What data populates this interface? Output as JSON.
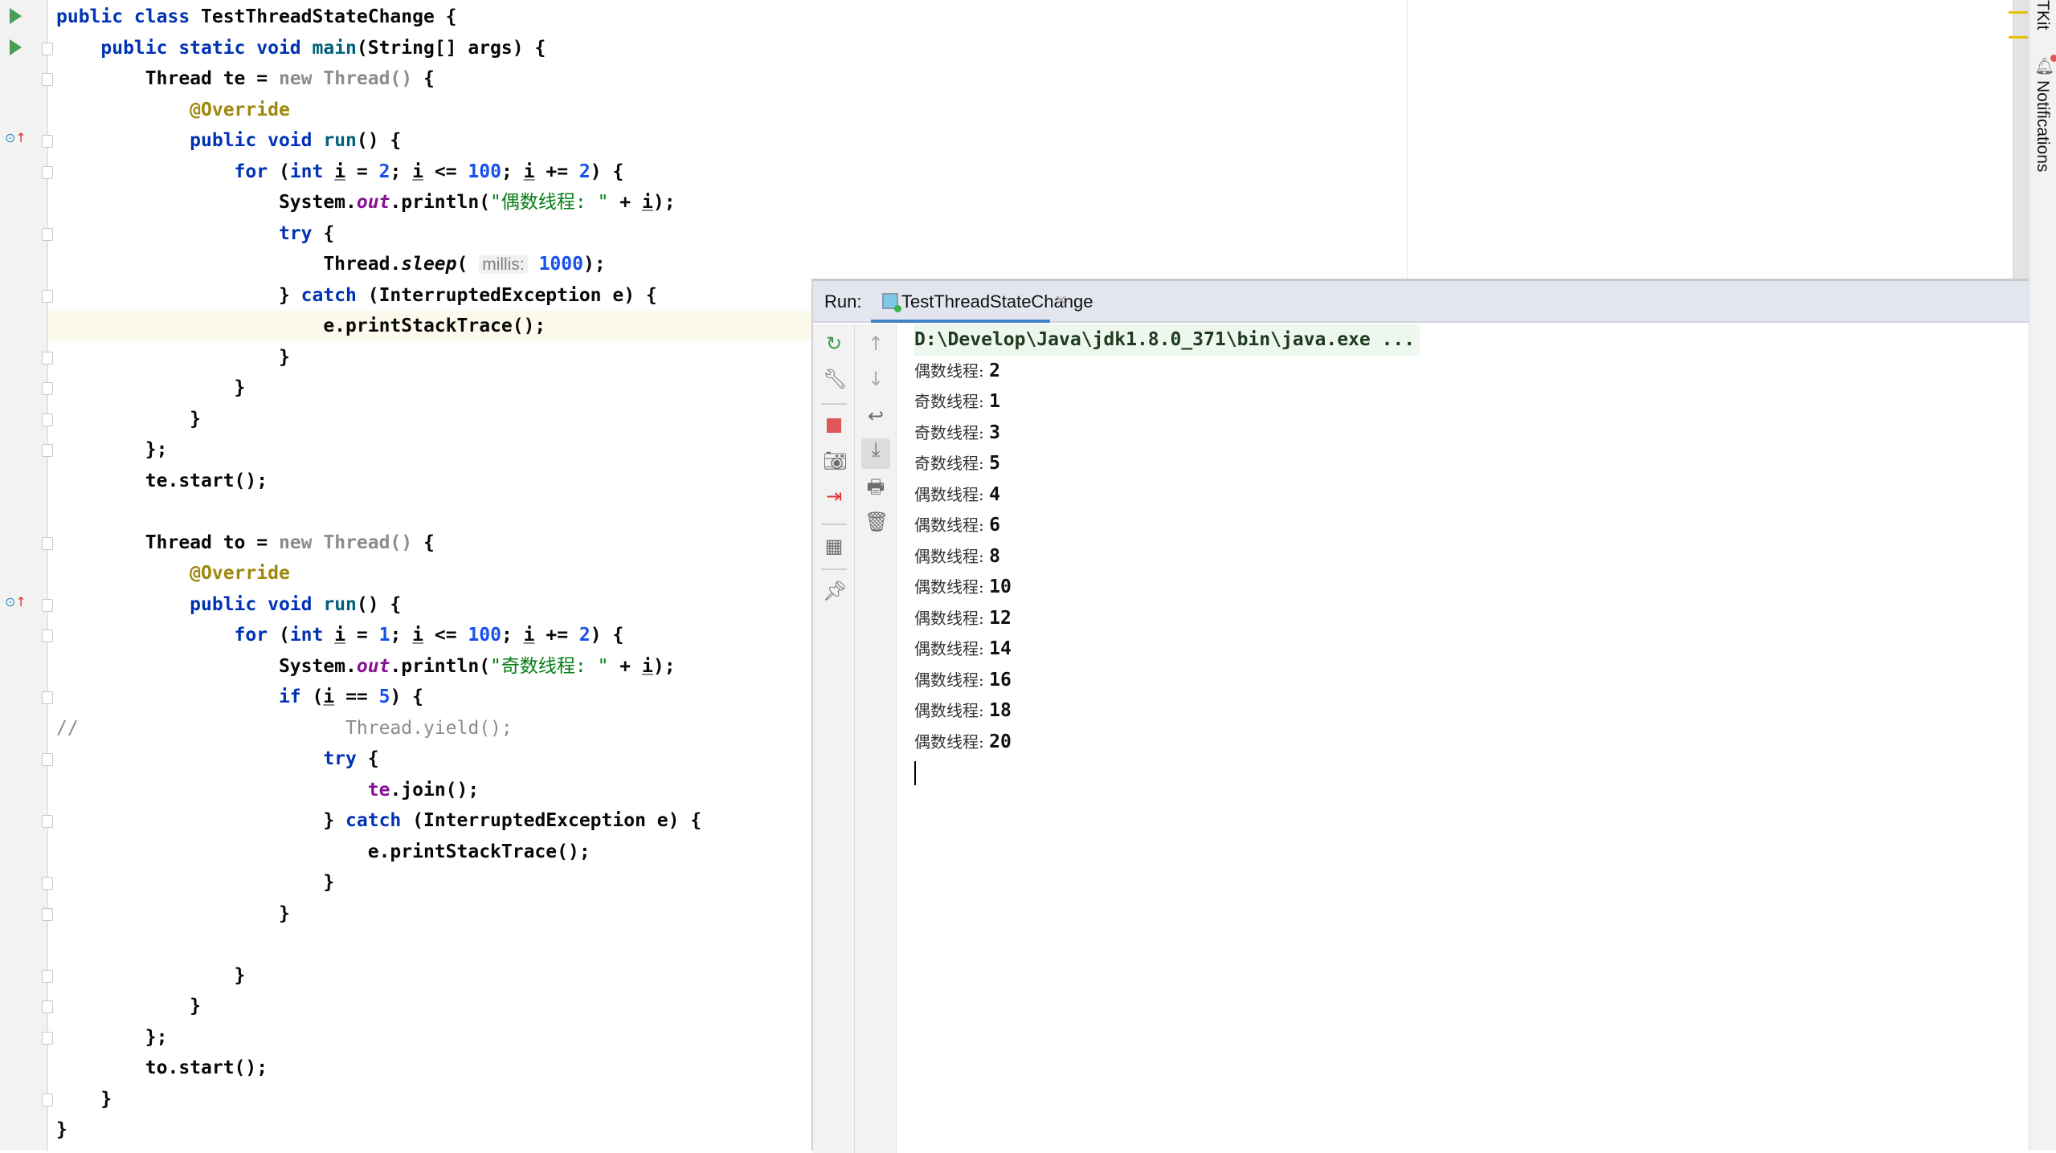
{
  "editor": {
    "highlighted_line": 10,
    "lines": [
      [
        [
          "public class ",
          "kw"
        ],
        [
          "TestThreadStateChange {",
          ""
        ]
      ],
      [
        [
          "    public static void ",
          "kw"
        ],
        [
          "main",
          "mth"
        ],
        [
          "(String[] args) {",
          ""
        ]
      ],
      [
        [
          "        Thread te = ",
          ""
        ],
        [
          "new Thread() ",
          "gray"
        ],
        [
          "{",
          ""
        ]
      ],
      [
        [
          "            @Override",
          "ann"
        ]
      ],
      [
        [
          "            public void ",
          "kw"
        ],
        [
          "run",
          "mth"
        ],
        [
          "() {",
          ""
        ]
      ],
      [
        [
          "                for ",
          "kw"
        ],
        [
          "(",
          ""
        ],
        [
          "int ",
          "kw"
        ],
        [
          "i",
          "u"
        ],
        [
          " = ",
          ""
        ],
        [
          "2",
          "num"
        ],
        [
          "; ",
          ""
        ],
        [
          "i",
          "u"
        ],
        [
          " <= ",
          ""
        ],
        [
          "100",
          "num"
        ],
        [
          "; ",
          ""
        ],
        [
          "i",
          "u"
        ],
        [
          " += ",
          ""
        ],
        [
          "2",
          "num"
        ],
        [
          ") {",
          ""
        ]
      ],
      [
        [
          "                    System.",
          ""
        ],
        [
          "out",
          "fld"
        ],
        [
          ".println(",
          ""
        ],
        [
          "\"偶数线程: \"",
          "str"
        ],
        [
          " + ",
          ""
        ],
        [
          "i",
          "u"
        ],
        [
          ");",
          ""
        ]
      ],
      [
        [
          "                    try ",
          "kw"
        ],
        [
          "{",
          ""
        ]
      ],
      [
        [
          "                        Thread.",
          ""
        ],
        [
          "sleep",
          "it"
        ],
        [
          "( ",
          ""
        ],
        [
          "millis:",
          "hint"
        ],
        [
          " ",
          ""
        ],
        [
          "1000",
          "num"
        ],
        [
          ");",
          ""
        ]
      ],
      [
        [
          "                    } ",
          ""
        ],
        [
          "catch ",
          "kw"
        ],
        [
          "(InterruptedException e) {",
          ""
        ]
      ],
      [
        [
          "                        e.printStackTrace();",
          ""
        ]
      ],
      [
        [
          "                    }",
          ""
        ]
      ],
      [
        [
          "                }",
          ""
        ]
      ],
      [
        [
          "            }",
          ""
        ]
      ],
      [
        [
          "        };",
          ""
        ]
      ],
      [
        [
          "        te.start();",
          ""
        ]
      ],
      [],
      [
        [
          "        Thread to = ",
          ""
        ],
        [
          "new Thread() ",
          "gray"
        ],
        [
          "{",
          ""
        ]
      ],
      [
        [
          "            @Override",
          "ann"
        ]
      ],
      [
        [
          "            public void ",
          "kw"
        ],
        [
          "run",
          "mth"
        ],
        [
          "() {",
          ""
        ]
      ],
      [
        [
          "                for ",
          "kw"
        ],
        [
          "(",
          ""
        ],
        [
          "int ",
          "kw"
        ],
        [
          "i",
          "u"
        ],
        [
          " = ",
          ""
        ],
        [
          "1",
          "num"
        ],
        [
          "; ",
          ""
        ],
        [
          "i",
          "u"
        ],
        [
          " <= ",
          ""
        ],
        [
          "100",
          "num"
        ],
        [
          "; ",
          ""
        ],
        [
          "i",
          "u"
        ],
        [
          " += ",
          ""
        ],
        [
          "2",
          "num"
        ],
        [
          ") {",
          ""
        ]
      ],
      [
        [
          "                    System.",
          ""
        ],
        [
          "out",
          "fld"
        ],
        [
          ".println(",
          ""
        ],
        [
          "\"奇数线程: \"",
          "str"
        ],
        [
          " + ",
          ""
        ],
        [
          "i",
          "u"
        ],
        [
          ");",
          ""
        ]
      ],
      [
        [
          "                    if ",
          "kw"
        ],
        [
          "(",
          ""
        ],
        [
          "i",
          "u"
        ],
        [
          " == ",
          ""
        ],
        [
          "5",
          "num"
        ],
        [
          ") {",
          ""
        ]
      ],
      [
        [
          "//                        Thread.yield();",
          "cmt"
        ]
      ],
      [
        [
          "                        try ",
          "kw"
        ],
        [
          "{",
          ""
        ]
      ],
      [
        [
          "                            ",
          ""
        ],
        [
          "te",
          "var"
        ],
        [
          ".join();",
          ""
        ]
      ],
      [
        [
          "                        } ",
          ""
        ],
        [
          "catch ",
          "kw"
        ],
        [
          "(InterruptedException e) {",
          ""
        ]
      ],
      [
        [
          "                            e.printStackTrace();",
          ""
        ]
      ],
      [
        [
          "                        }",
          ""
        ]
      ],
      [
        [
          "                    }",
          ""
        ]
      ],
      [],
      [
        [
          "                }",
          ""
        ]
      ],
      [
        [
          "            }",
          ""
        ]
      ],
      [
        [
          "        };",
          ""
        ]
      ],
      [
        [
          "        to.start();",
          ""
        ]
      ],
      [
        [
          "    }",
          ""
        ]
      ],
      [
        [
          "}",
          ""
        ]
      ]
    ]
  },
  "right_strip": {
    "top_label": "TKit",
    "notifications_label": "Notifications"
  },
  "run": {
    "label": "Run:",
    "tab_label": "TestThreadStateChange",
    "command": "D:\\Develop\\Java\\jdk1.8.0_371\\bin\\java.exe ...",
    "output": [
      [
        "偶数线程: ",
        "2"
      ],
      [
        "奇数线程: ",
        "1"
      ],
      [
        "奇数线程: ",
        "3"
      ],
      [
        "奇数线程: ",
        "5"
      ],
      [
        "偶数线程: ",
        "4"
      ],
      [
        "偶数线程: ",
        "6"
      ],
      [
        "偶数线程: ",
        "8"
      ],
      [
        "偶数线程: ",
        "10"
      ],
      [
        "偶数线程: ",
        "12"
      ],
      [
        "偶数线程: ",
        "14"
      ],
      [
        "偶数线程: ",
        "16"
      ],
      [
        "偶数线程: ",
        "18"
      ],
      [
        "偶数线程: ",
        "20"
      ]
    ],
    "toolbar_icons": [
      "rerun-icon",
      "settings-wrench-icon",
      "stop-icon",
      "screenshot-camera-icon",
      "login-exit-icon",
      "layout-icon",
      "pin-icon"
    ],
    "toolbar2_icons": [
      "up-arrow-icon",
      "down-arrow-icon",
      "soft-wrap-icon",
      "scroll-to-end-icon",
      "print-icon",
      "trash-icon"
    ]
  },
  "colors": {
    "keyword": "#0033b3",
    "number": "#1750eb",
    "string": "#067d17",
    "annotation": "#9e880d",
    "field": "#871094",
    "accent": "#4083c9",
    "stop": "#e05555"
  }
}
